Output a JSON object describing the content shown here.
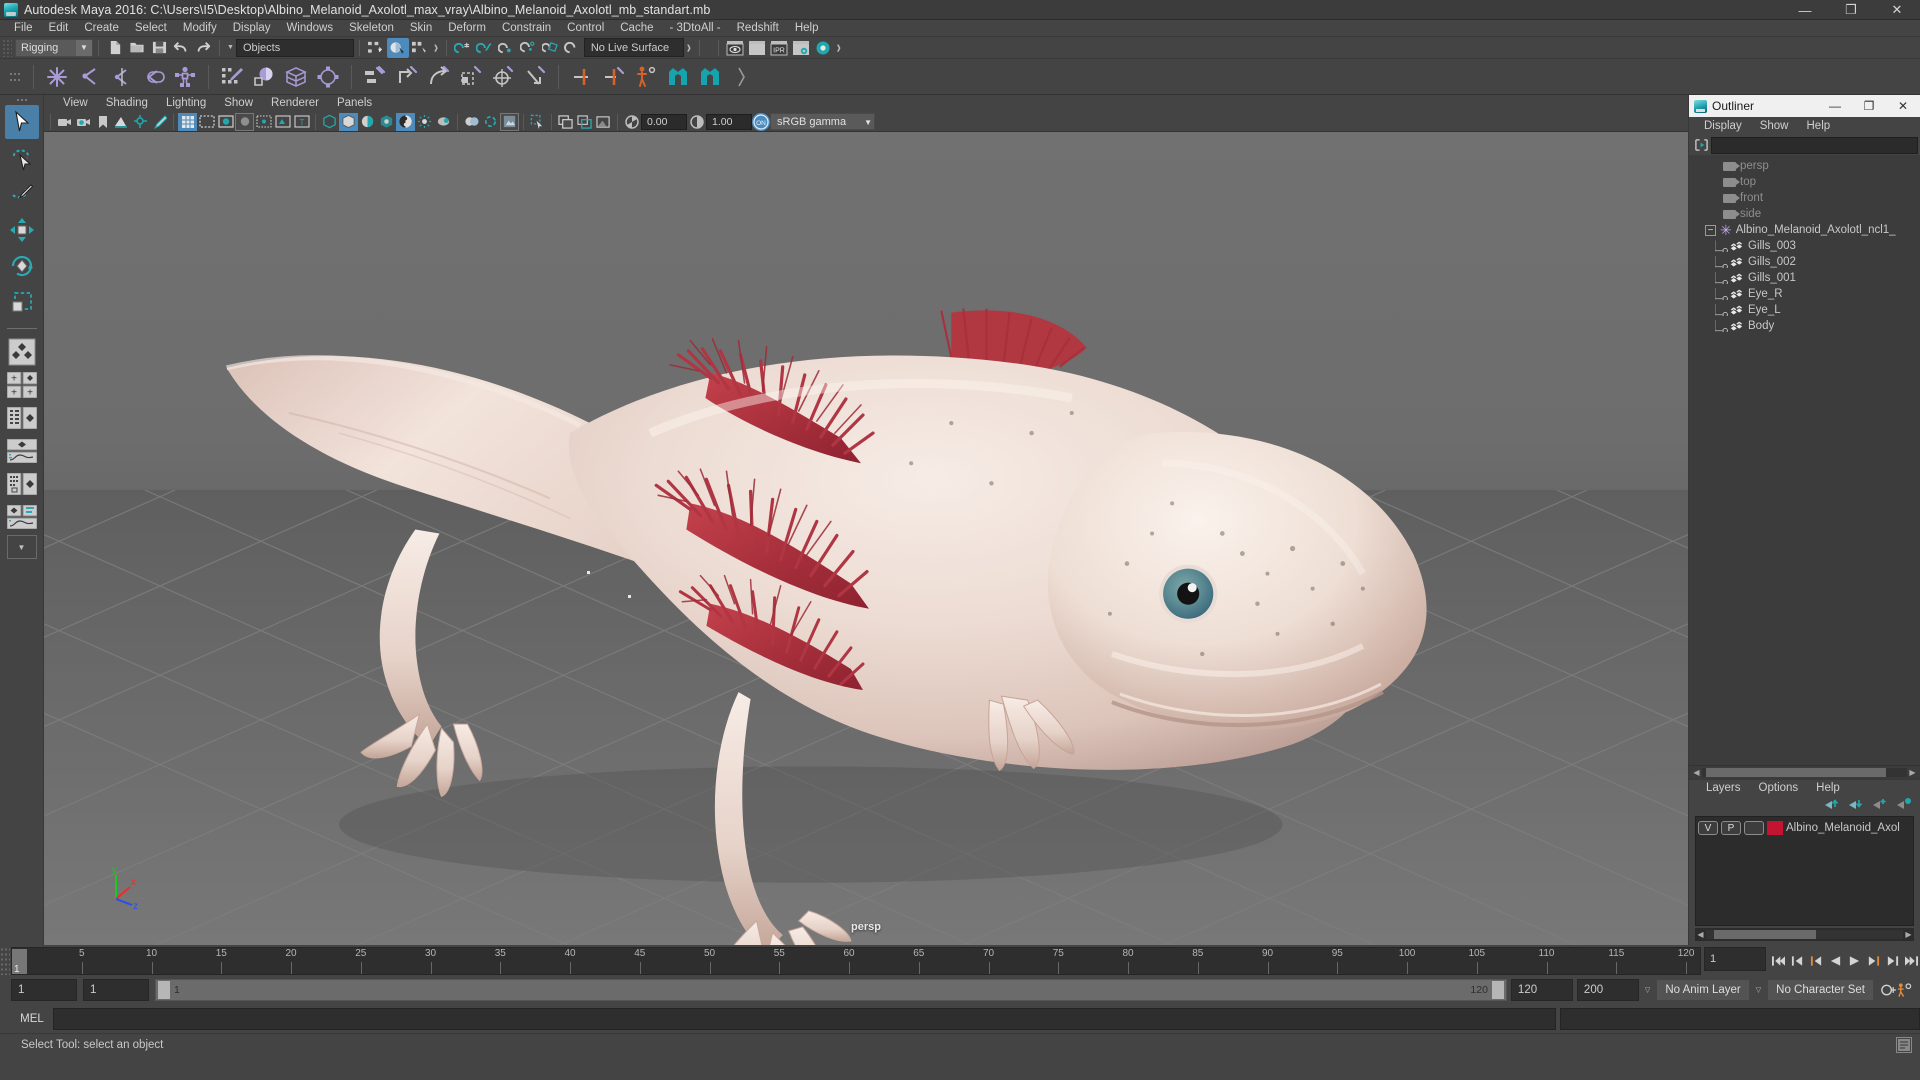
{
  "window": {
    "title": "Autodesk Maya 2016: C:\\Users\\I5\\Desktop\\Albino_Melanoid_Axolotl_max_vray\\Albino_Melanoid_Axolotl_mb_standart.mb",
    "minimize": "—",
    "maximize": "❐",
    "close": "✕"
  },
  "menubar": {
    "items": [
      {
        "label": "File"
      },
      {
        "label": "Edit"
      },
      {
        "label": "Create"
      },
      {
        "label": "Select"
      },
      {
        "label": "Modify"
      },
      {
        "label": "Display"
      },
      {
        "label": "Windows"
      },
      {
        "label": "Skeleton"
      },
      {
        "label": "Skin"
      },
      {
        "label": "Deform"
      },
      {
        "label": "Constrain"
      },
      {
        "label": "Control"
      },
      {
        "label": "Cache"
      },
      {
        "label": "- 3DtoAll -"
      },
      {
        "label": "Redshift"
      },
      {
        "label": "Help"
      }
    ]
  },
  "statusline": {
    "menuset": "Rigging",
    "selection_mask": "Objects",
    "live_surface": "No Live Surface",
    "ipr_label": "IPR"
  },
  "viewport_panel": {
    "menus": [
      {
        "label": "View"
      },
      {
        "label": "Shading"
      },
      {
        "label": "Lighting"
      },
      {
        "label": "Show"
      },
      {
        "label": "Renderer"
      },
      {
        "label": "Panels"
      }
    ],
    "exposure": "0.00",
    "gamma": "1.00",
    "color_profile": "sRGB gamma",
    "camera_label": "persp",
    "axis": {
      "x": "x",
      "y": "y",
      "z": "z"
    }
  },
  "outliner": {
    "title": "Outliner",
    "minimize": "—",
    "maximize": "❐",
    "close": "✕",
    "menus": [
      {
        "label": "Display"
      },
      {
        "label": "Show"
      },
      {
        "label": "Help"
      }
    ],
    "search_value": "",
    "items": [
      {
        "label": "persp",
        "type": "camera",
        "depth": 0,
        "dim": true
      },
      {
        "label": "top",
        "type": "camera",
        "depth": 0,
        "dim": true
      },
      {
        "label": "front",
        "type": "camera",
        "depth": 0,
        "dim": true
      },
      {
        "label": "side",
        "type": "camera",
        "depth": 0,
        "dim": true
      },
      {
        "label": "Albino_Melanoid_Axolotl_ncl1_",
        "type": "group",
        "depth": 0,
        "dim": false,
        "expanded": true
      },
      {
        "label": "Gills_003",
        "type": "mesh",
        "depth": 1,
        "dim": false
      },
      {
        "label": "Gills_002",
        "type": "mesh",
        "depth": 1,
        "dim": false
      },
      {
        "label": "Gills_001",
        "type": "mesh",
        "depth": 1,
        "dim": false
      },
      {
        "label": "Eye_R",
        "type": "mesh",
        "depth": 1,
        "dim": false
      },
      {
        "label": "Eye_L",
        "type": "mesh",
        "depth": 1,
        "dim": false
      },
      {
        "label": "Body",
        "type": "mesh",
        "depth": 1,
        "dim": false
      }
    ],
    "expander_glyph": "−"
  },
  "layers": {
    "menus": [
      {
        "label": "Layers"
      },
      {
        "label": "Options"
      },
      {
        "label": "Help"
      }
    ],
    "rows": [
      {
        "visibility": "V",
        "playback": "P",
        "shading": "",
        "color": "#c41432",
        "name": "Albino_Melanoid_Axol"
      }
    ]
  },
  "timeline": {
    "ticks": [
      5,
      10,
      15,
      20,
      25,
      30,
      35,
      40,
      45,
      50,
      55,
      60,
      65,
      70,
      75,
      80,
      85,
      90,
      95,
      100,
      105,
      110,
      115,
      120
    ],
    "current_frame": "1",
    "current_frame_field": "1",
    "range_start_field": "1",
    "range_end_field": "1",
    "range_bar_start": "1",
    "range_bar_end": "120",
    "anim_end": "120",
    "playback_end": "200",
    "anim_layer": "No Anim Layer",
    "character_set": "No Character Set"
  },
  "command_line": {
    "language": "MEL",
    "input_value": "",
    "output_value": ""
  },
  "statusbar": {
    "help_text": "Select Tool: select an object"
  },
  "colors": {
    "accent_blue": "#4d8bbd",
    "shelf_purple": "#a99ad8",
    "shelf_teal": "#1fa8ae",
    "shelf_orange": "#d4622a",
    "layer_red": "#c41432",
    "panel_bg": "#444444",
    "dark_field": "#2e2e2e"
  }
}
